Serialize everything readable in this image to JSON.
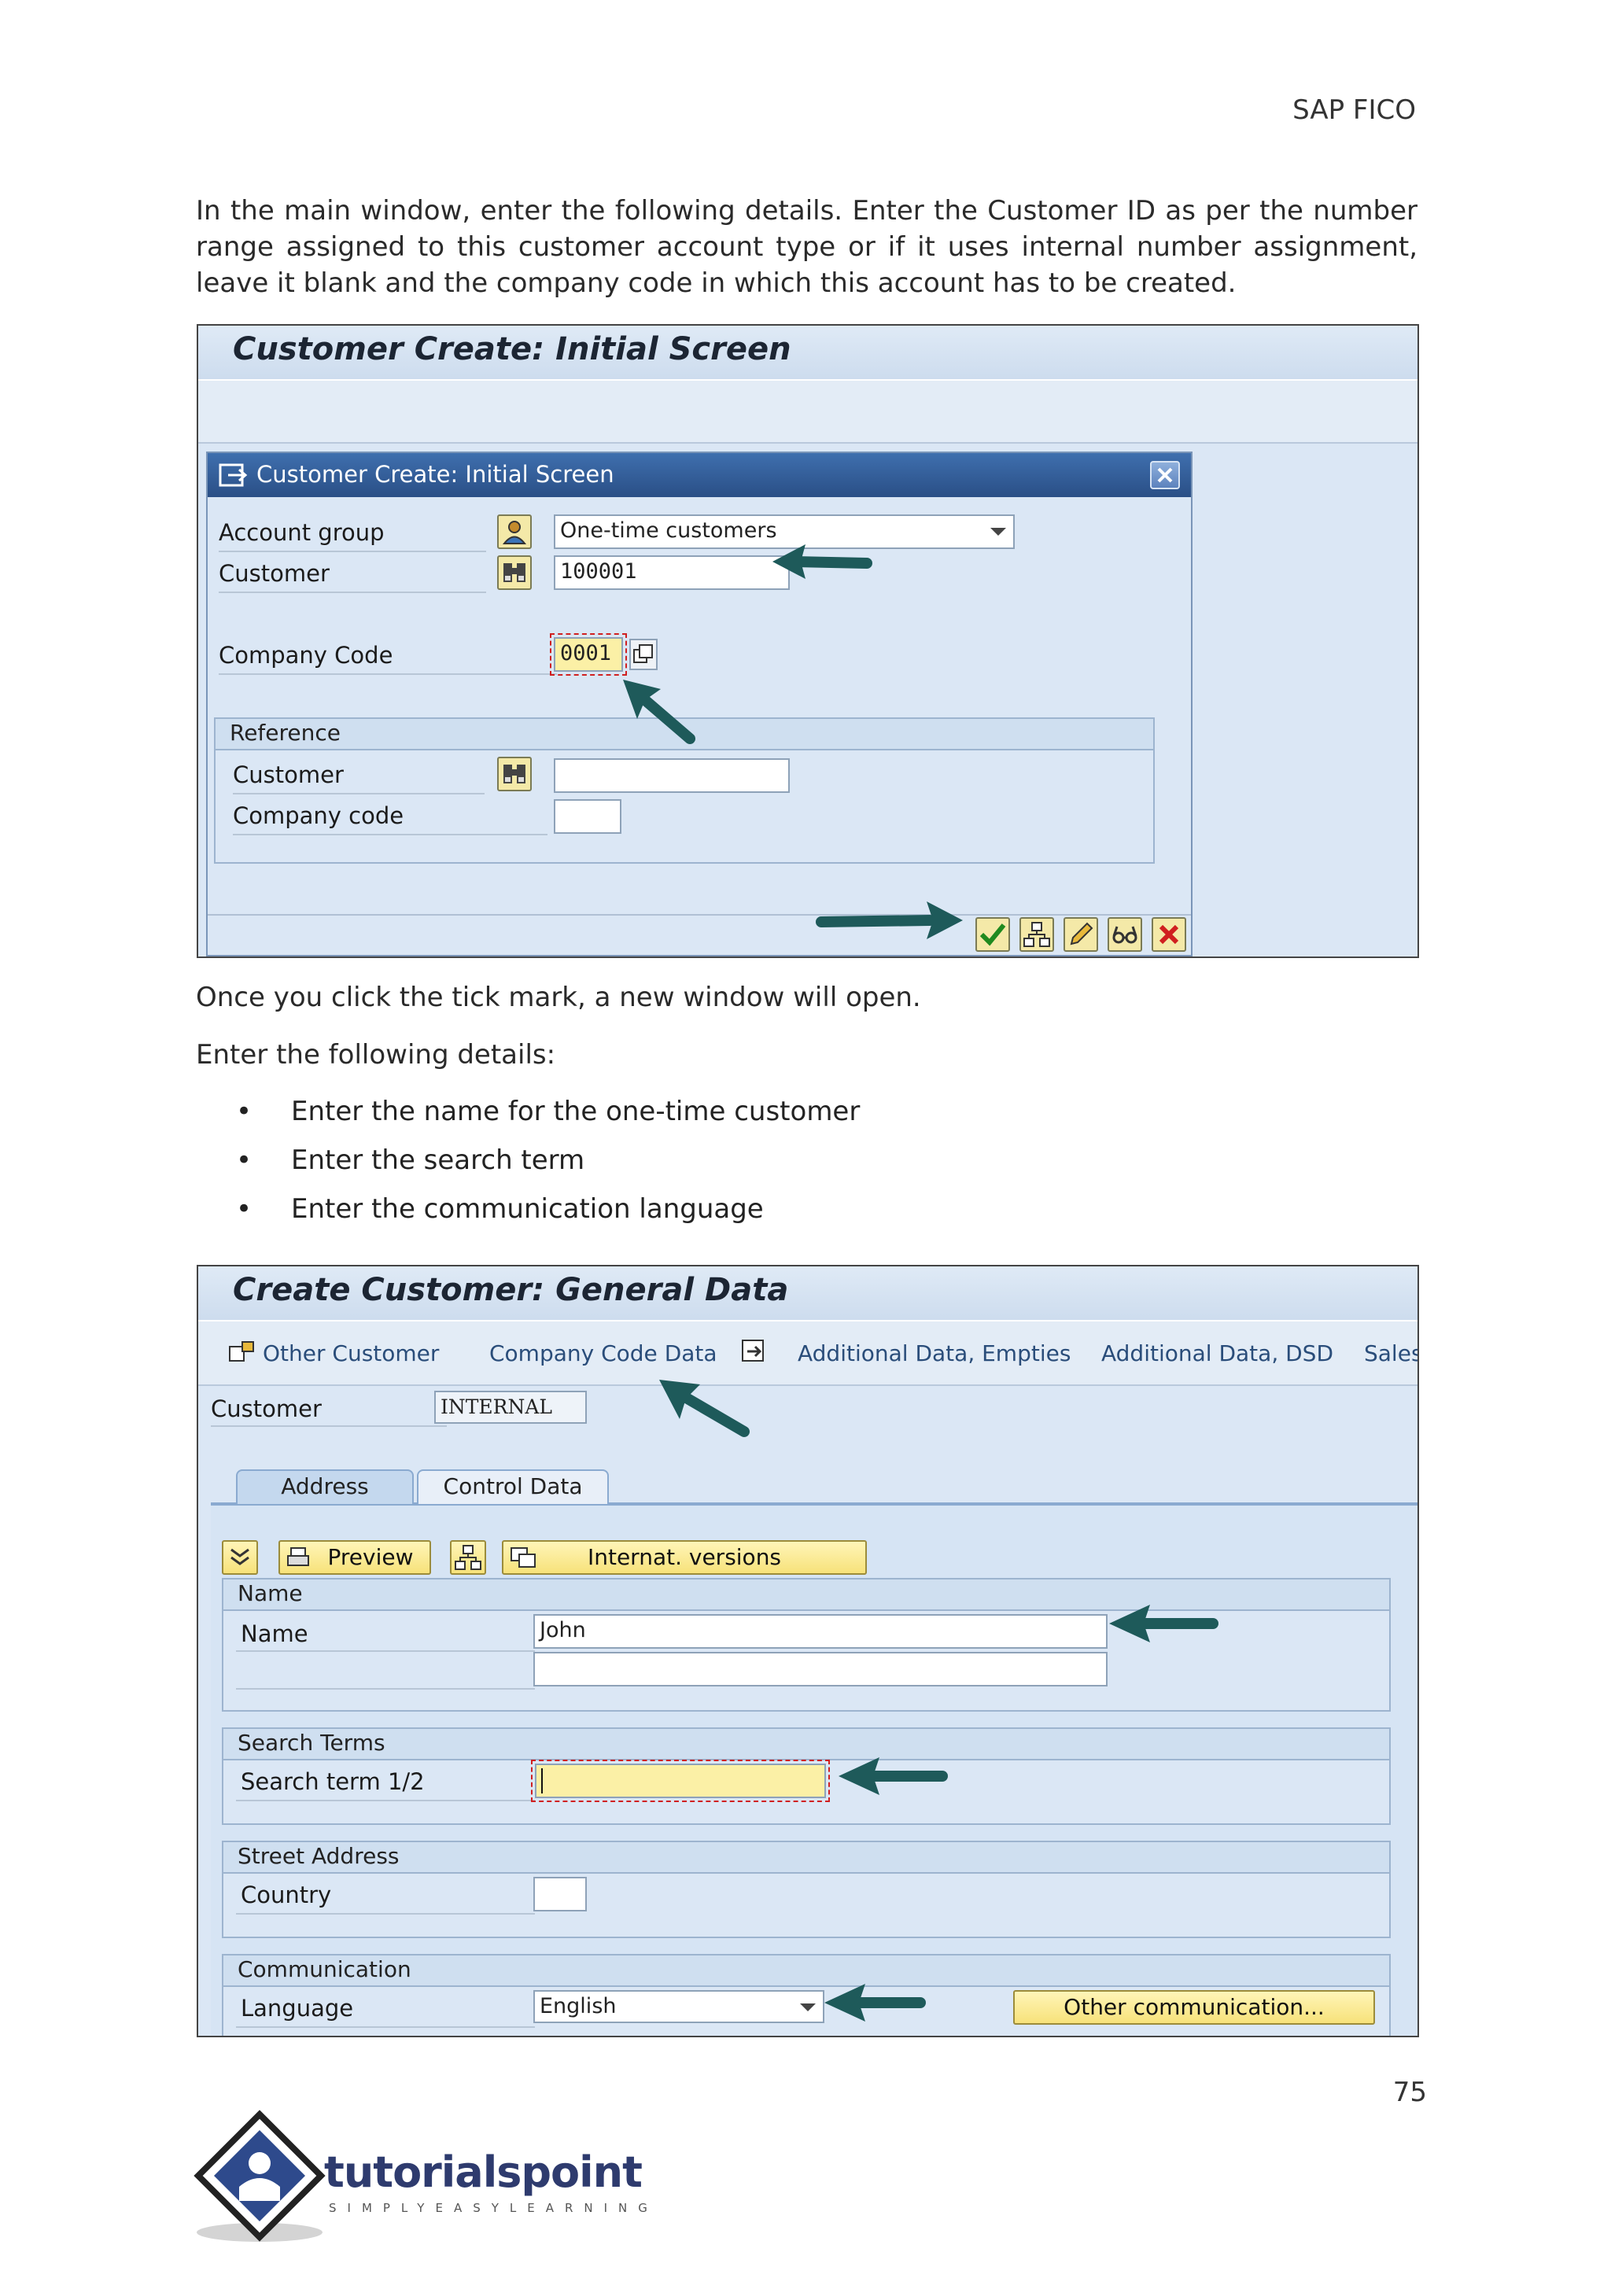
{
  "header": {
    "label": "SAP FICO"
  },
  "intro_text": "In the main window, enter the following details. Enter the Customer ID as per the number range assigned to this customer account type or if it uses internal number assignment, leave it blank and the company code in which this account has to be created.",
  "screenshot1": {
    "title": "Customer Create: Initial Screen",
    "dialog": {
      "title": "Customer Create: Initial Screen",
      "account_group_label": "Account group",
      "account_group_value": "One-time customers",
      "customer_label": "Customer",
      "customer_value": "100001",
      "company_code_label": "Company Code",
      "company_code_value": "0001",
      "reference": {
        "title": "Reference",
        "customer_label": "Customer",
        "customer_value": "",
        "company_code_label": "Company code",
        "company_code_value": ""
      },
      "footer_icons": [
        "check-icon",
        "hierarchy-icon",
        "edit-icon",
        "glasses-icon",
        "cancel-icon"
      ]
    }
  },
  "text_after_shot1": "Once you click the tick mark, a new window will open.",
  "enter_details": "Enter the following details:",
  "bullets": [
    "Enter the name for the one-time customer",
    "Enter the search term",
    "Enter the communication language"
  ],
  "screenshot2": {
    "title": "Create Customer: General Data",
    "toolbar": {
      "other_customer": "Other Customer",
      "company_code_data": "Company Code Data",
      "additional_empties": "Additional Data, Empties",
      "additional_dsd": "Additional Data, DSD",
      "sales": "Sales"
    },
    "customer_label": "Customer",
    "customer_value": "INTERNAL",
    "tabs": [
      "Address",
      "Control Data"
    ],
    "buttons": {
      "preview": "Preview",
      "internat": "Internat. versions"
    },
    "name_group": {
      "title": "Name",
      "name_label": "Name",
      "name_value": "John",
      "name2_value": ""
    },
    "search_group": {
      "title": "Search Terms",
      "label": "Search term 1/2",
      "value": ""
    },
    "street_group": {
      "title": "Street Address",
      "country_label": "Country",
      "country_value": ""
    },
    "comm_group": {
      "title": "Communication",
      "language_label": "Language",
      "language_value": "English",
      "other_button": "Other communication..."
    }
  },
  "page_number": "75",
  "logo": {
    "text": "tutorialspoint",
    "tagline": "SIMPLYEASYLEARNING"
  },
  "colors": {
    "arrow": "#1e5a5a",
    "sap_bg": "#dbe7f5",
    "button_yellow": "#f7e27a",
    "required_yellow": "#fbf0a6"
  }
}
